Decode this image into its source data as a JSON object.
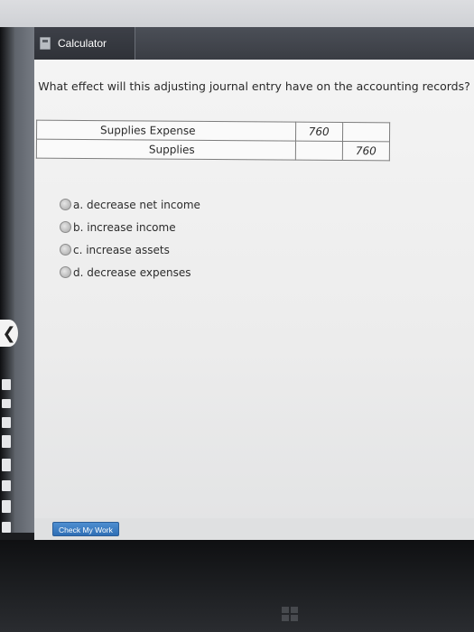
{
  "window": {
    "title": "Calculator"
  },
  "question": "What effect will this adjusting journal entry have on the accounting records?",
  "journal_entry": [
    {
      "account": "Supplies Expense",
      "debit": "760",
      "credit": ""
    },
    {
      "account": "Supplies",
      "debit": "",
      "credit": "760"
    }
  ],
  "options": [
    {
      "label": "a. decrease net income"
    },
    {
      "label": "b. increase income"
    },
    {
      "label": "c. increase assets"
    },
    {
      "label": "d. decrease expenses"
    }
  ],
  "actions": {
    "check_label": "Check My Work"
  },
  "colors": {
    "accent": "#2f6fb5",
    "titlebar": "#3a3d44"
  }
}
